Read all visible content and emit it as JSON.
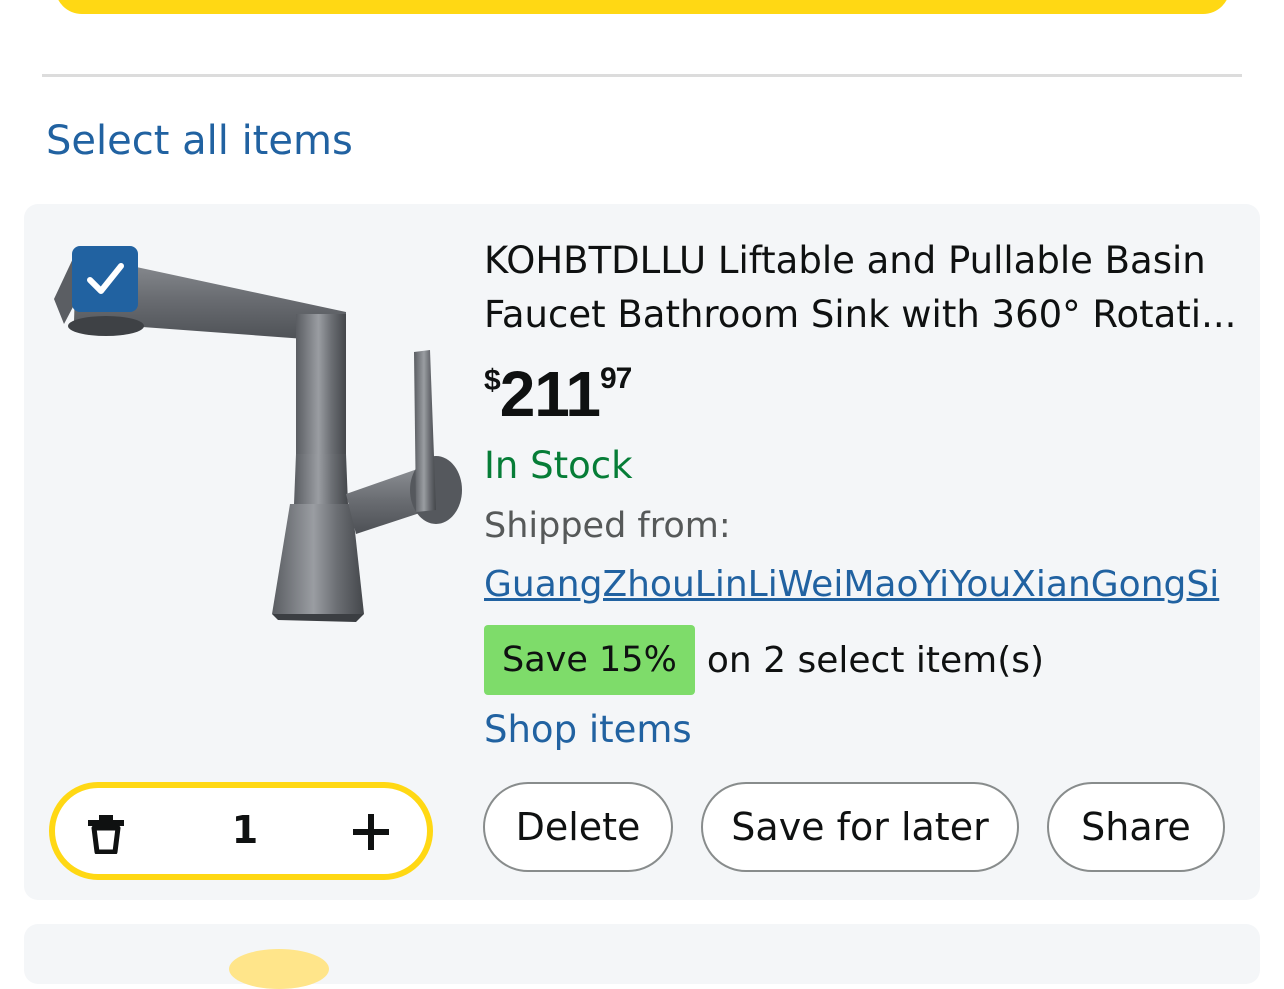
{
  "header": {
    "select_all": "Select all items"
  },
  "item": {
    "title": "KOHBTDLLU Liftable and Pullable Basin Faucet Bathroom Sink with 360° Rotati...",
    "price": {
      "symbol": "$",
      "whole": "211",
      "fraction": "97"
    },
    "stock": "In Stock",
    "shipped_from_label": "Shipped from:",
    "seller": "GuangZhouLinLiWeiMaoYiYouXianGongSi",
    "promo": {
      "badge": "Save 15%",
      "text": "on 2 select item(s)"
    },
    "shop_link": "Shop items",
    "quantity": "1",
    "checked": true,
    "actions": {
      "delete": "Delete",
      "save_for_later": "Save for later",
      "share": "Share"
    }
  },
  "colors": {
    "accent_yellow": "#ffd814",
    "link_blue": "#2162a1",
    "stock_green": "#067d37",
    "promo_green": "#7edc6a"
  },
  "icons": [
    "checkmark-icon",
    "trash-icon",
    "plus-icon"
  ]
}
